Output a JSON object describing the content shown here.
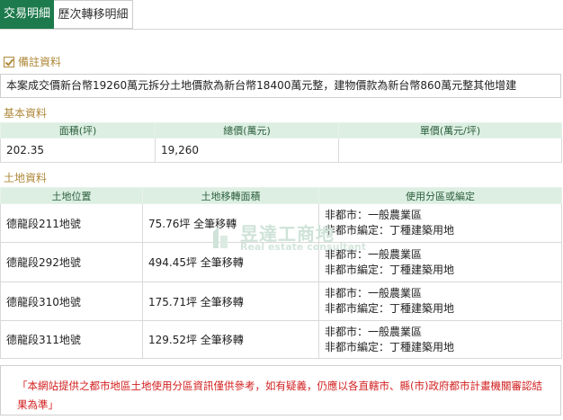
{
  "tabs": [
    {
      "label": "交易明細",
      "active": true
    },
    {
      "label": "歷次轉移明細",
      "active": false
    }
  ],
  "note": {
    "title": "備註資料",
    "text": "本案成交價新台幣19260萬元拆分土地價款為新台幣18400萬元整，建物價款為新台幣860萬元整其他增建"
  },
  "basic": {
    "title": "基本資料",
    "headers": [
      "面積(坪)",
      "總價(萬元)",
      "單價(萬元/坪)"
    ],
    "row": [
      "202.35",
      "19,260",
      ""
    ]
  },
  "land": {
    "title": "土地資料",
    "headers": [
      "土地位置",
      "土地移轉面積",
      "使用分區或編定"
    ],
    "rows": [
      {
        "location": "德龍段211地號",
        "area": "75.76坪 全筆移轉",
        "zone1": "非都市：一般農業區",
        "zone2": "非都市編定：丁種建築用地"
      },
      {
        "location": "德龍段292地號",
        "area": "494.45坪 全筆移轉",
        "zone1": "非都市：一般農業區",
        "zone2": "非都市編定：丁種建築用地"
      },
      {
        "location": "德龍段310地號",
        "area": "175.71坪 全筆移轉",
        "zone1": "非都市：一般農業區",
        "zone2": "非都市編定：丁種建築用地"
      },
      {
        "location": "德龍段311地號",
        "area": "129.52坪 全筆移轉",
        "zone1": "非都市：一般農業區",
        "zone2": "非都市編定：丁種建築用地"
      }
    ]
  },
  "watermark": {
    "brand": "昱達工商地",
    "sub": "Real estate consultant"
  },
  "disclaimer": "「本網站提供之都市地區土地使用分區資訊僅供參考，如有疑義，仍應以各直轄市、縣(市)政府都市計畫機關審認結果為準」",
  "colors": {
    "accent": "#1d7a4c",
    "section": "#b08a3c",
    "header_bg": "#dcefe2",
    "disclaimer": "#d21f1f"
  }
}
